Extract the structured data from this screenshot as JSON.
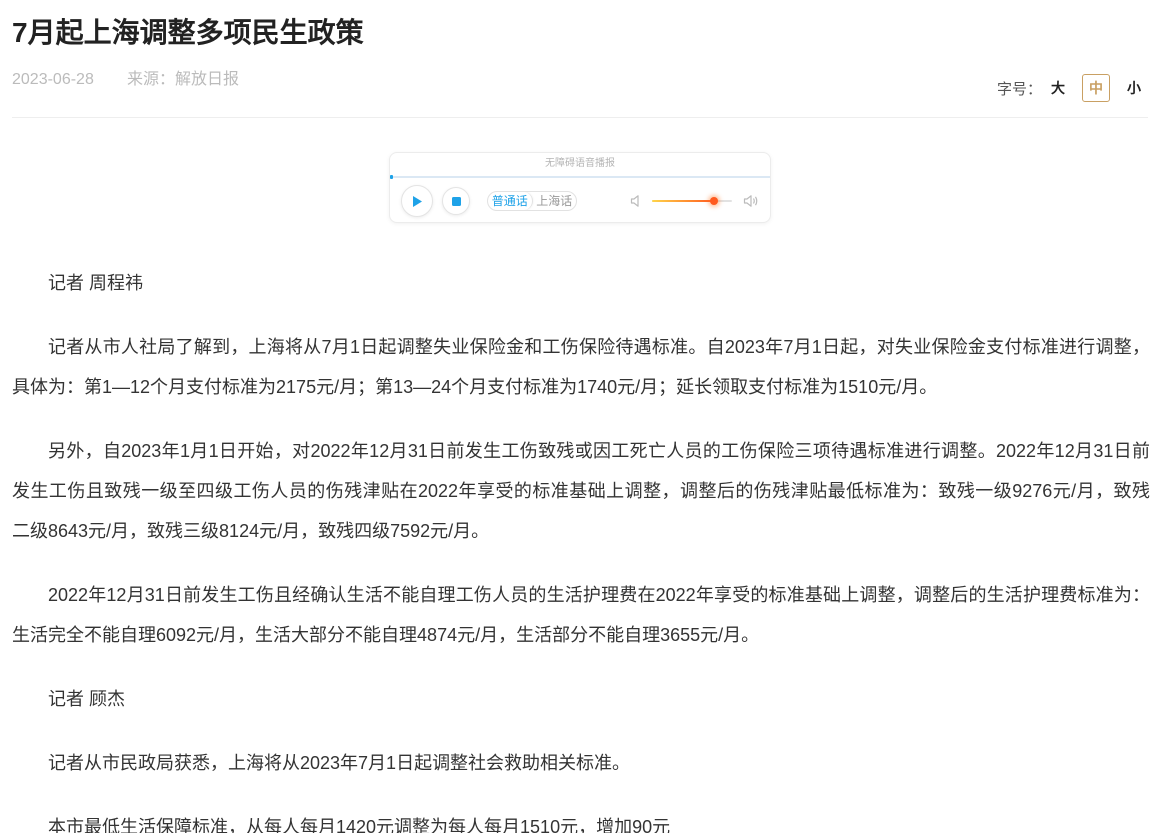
{
  "article": {
    "title": "7月起上海调整多项民生政策",
    "date": "2023-06-28",
    "source": "来源：解放日报",
    "paragraphs": [
      [
        "记者 周程祎"
      ],
      [
        "记者从市人社局了解到，上海将从7月1日起调整失业保险金和工伤保险待遇标准。自2023年7月1日起，对失业保险金支付标准进行调整，",
        "具体为：第1—12个月支付标准为2175元/月；第13—24个月支付标准为1740元/月；延长领取支付标准为1510元/月。"
      ],
      [
        "另外，自2023年1月1日开始，对2022年12月31日前发生工伤致残或因工死亡人员的工伤保险三项待遇标准进行调整。2022年12月31日前",
        "发生工伤且致残一级至四级工伤人员的伤残津贴在2022年享受的标准基础上调整，调整后的伤残津贴最低标准为：致残一级9276元/月，致残",
        "二级8643元/月，致残三级8124元/月，致残四级7592元/月。"
      ],
      [
        "2022年12月31日前发生工伤且经确认生活不能自理工伤人员的生活护理费在2022年享受的标准基础上调整，调整后的生活护理费标准为：",
        "生活完全不能自理6092元/月，生活大部分不能自理4874元/月，生活部分不能自理3655元/月。"
      ],
      [
        "记者 顾杰"
      ],
      [
        "记者从市民政局获悉，上海将从2023年7月1日起调整社会救助相关标准。"
      ],
      [
        "本市最低生活保障标准，从每人每月1420元调整为每人每月1510元，增加90元"
      ]
    ]
  },
  "font_size_control": {
    "label": "字号：",
    "options": [
      "大",
      "中",
      "小"
    ],
    "selected": "中"
  },
  "audio_player": {
    "title": "无障碍语音播报",
    "progress": 0,
    "languages": [
      "普通话",
      "上海话"
    ],
    "selected_language": "普通话",
    "volume": 0.78,
    "icons": {
      "play": "play-icon",
      "stop": "stop-icon",
      "volume_low": "volume-low-icon",
      "volume_high": "volume-high-icon"
    }
  },
  "colors": {
    "accent": "#1ea2e8",
    "selected_option": "#c9a063",
    "text": "#333333",
    "meta": "#bbbbbb",
    "volume_start": "#ffd54a",
    "volume_end": "#ff5a1f"
  }
}
